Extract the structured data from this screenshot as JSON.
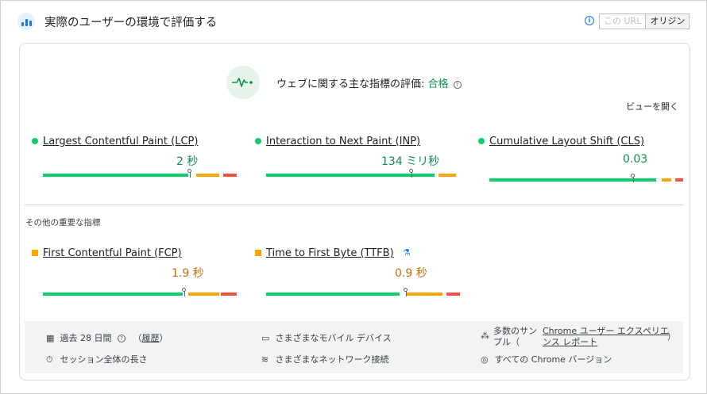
{
  "header": {
    "title": "実際のユーザーの環境で評価する",
    "toggle_url": "この URL",
    "toggle_origin": "オリジン"
  },
  "assessment": {
    "label": "ウェブに関する主な指標の評価: ",
    "result": "合格",
    "expand_label": "ビューを開く"
  },
  "core_metrics": [
    {
      "name": "Largest Contentful Paint (LCP)",
      "value": "2 秒",
      "status": "good",
      "marker_fraction": 0.76,
      "distribution": [
        0.75,
        0.04,
        0.12,
        0.02,
        0.07
      ]
    },
    {
      "name": "Interaction to Next Paint (INP)",
      "value": "134 ミリ秒",
      "status": "good",
      "marker_fraction": 0.75,
      "distribution": [
        0.87,
        0.02,
        0.09,
        0.02,
        0.0
      ]
    },
    {
      "name": "Cumulative Layout Shift (CLS)",
      "value": "0.03",
      "status": "good",
      "marker_fraction": 0.74,
      "distribution": [
        0.86,
        0.03,
        0.05,
        0.02,
        0.04
      ]
    }
  ],
  "other_section_title": "その他の重要な指標",
  "other_metrics": [
    {
      "name": "First Contentful Paint (FCP)",
      "value": "1.9 秒",
      "status": "average",
      "marker_fraction": 0.73,
      "distribution": [
        0.72,
        0.03,
        0.16,
        0.01,
        0.08
      ]
    },
    {
      "name": "Time to First Byte (TTFB)",
      "value": "0.9 秒",
      "status": "average",
      "marker_fraction": 0.72,
      "distribution": [
        0.69,
        0.03,
        0.19,
        0.02,
        0.07
      ]
    }
  ],
  "footer": {
    "period": "過去 28 日間",
    "period_help": "?",
    "history_paren_open": "（",
    "history_link": "履歴",
    "history_paren_close": "）",
    "devices": "さまざまなモバイル デバイス",
    "samples_prefix": "多数のサン",
    "samples_line2": "プル（",
    "report_link_1": "Chrome ユーザー エクスペリエ",
    "report_link_2": "ンス レポート",
    "samples_close": "）",
    "session": "セッション全体の長さ",
    "network": "さまざまなネットワーク接続",
    "chrome_versions": "すべての Chrome バージョン"
  },
  "colors": {
    "good": "#0cce6b",
    "average": "#ffa400",
    "poor": "#ff4e42"
  }
}
